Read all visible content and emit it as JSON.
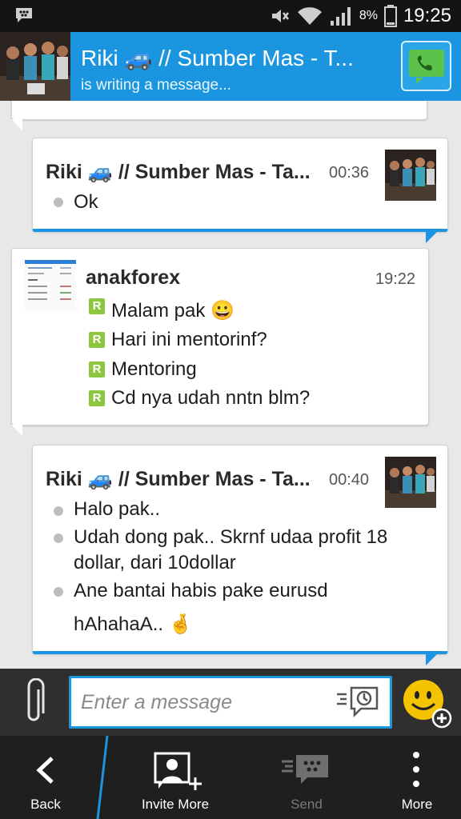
{
  "status_bar": {
    "battery_percent": "8%",
    "time": "19:25",
    "icons": [
      "bbm-notification-icon",
      "mute-icon",
      "wifi-icon",
      "signal-icon",
      "battery-icon"
    ]
  },
  "header": {
    "contact_name": "Riki 🚙  // Sumber Mas - T...",
    "status": "is writing a message...",
    "accent": "#1b95e0"
  },
  "messages": [
    {
      "sender": "Riki 🚙  // Sumber Mas - Ta...",
      "time": "00:36",
      "lines": [
        "Ok"
      ]
    },
    {
      "sender": "anakforex",
      "time": "19:22",
      "lines": [
        "Malam pak 😀",
        "Hari ini mentorinf?",
        "Mentoring",
        "Cd nya udah nntn blm?"
      ]
    },
    {
      "sender": "Riki 🚙  // Sumber Mas - Ta...",
      "time": "00:40",
      "lines": [
        "Halo pak..",
        "Udah dong pak.. Skrnf udaa profit 18",
        "dollar, dari 10dollar",
        "Ane bantai habis pake eurusd",
        "hAhahaA.. 🤞"
      ]
    }
  ],
  "composer": {
    "placeholder": "Enter a message"
  },
  "bottom_nav": {
    "back": "Back",
    "invite": "Invite More",
    "send": "Send",
    "more": "More"
  }
}
